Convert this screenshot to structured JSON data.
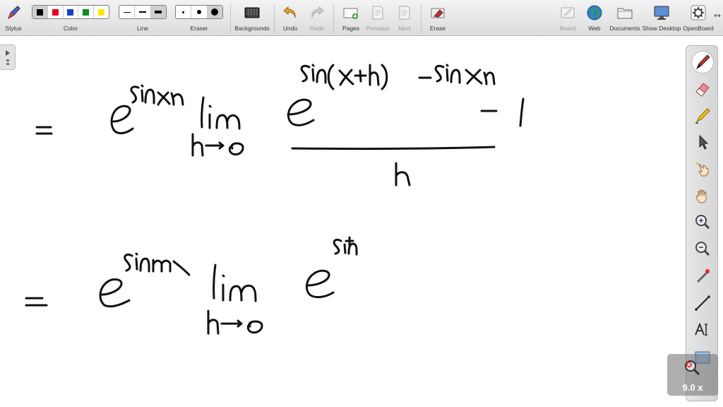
{
  "toolbar": {
    "stylus": "Stylus",
    "color": "Color",
    "line": "Line",
    "eraser": "Eraser",
    "backgrounds": "Backgrounds",
    "undo": "Undo",
    "redo": "Redo",
    "pages": "Pages",
    "previous": "Previous",
    "next": "Next",
    "erase": "Erase",
    "board": "Board",
    "web": "Web",
    "documents": "Documents",
    "show_desktop": "Show Desktop",
    "openboard": "OpenBoard"
  },
  "colors": {
    "palette": [
      "#000000",
      "#e8001c",
      "#1a3ec8",
      "#0b8f1e",
      "#ffe600"
    ],
    "ink": "#111111",
    "toolbar_bg": "#e6e6e6"
  },
  "icons": {
    "stylus": "stylus-icon",
    "undo": "undo-arrow-icon",
    "redo": "redo-arrow-icon",
    "web": "globe-icon",
    "documents": "folder-icon",
    "show_desktop": "monitor-icon",
    "openboard": "gear-icon"
  },
  "zoom": {
    "level": "9.0 x"
  }
}
